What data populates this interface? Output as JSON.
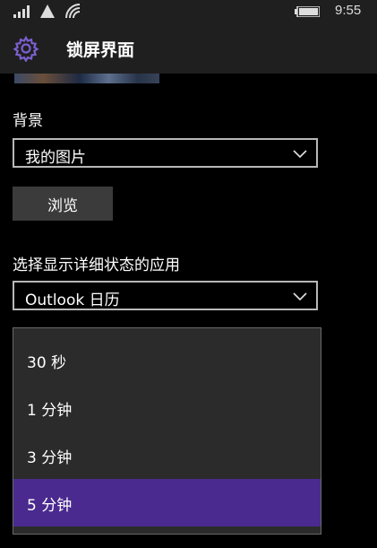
{
  "status_bar": {
    "time": "9:55"
  },
  "header": {
    "title": "锁屏界面"
  },
  "background": {
    "label": "背景",
    "selected": "我的图片",
    "browse_label": "浏览"
  },
  "detail_app": {
    "label": "选择显示详细状态的应用",
    "selected": "Outlook 日历"
  },
  "timeout_dropdown": {
    "options": [
      "30 秒",
      "1 分钟",
      "3 分钟",
      "5 分钟"
    ],
    "selected": "5 分钟"
  },
  "colors": {
    "accent": "#4a2a8e",
    "chrome": "#1f1f1f",
    "gear": "#7b5fd0"
  }
}
